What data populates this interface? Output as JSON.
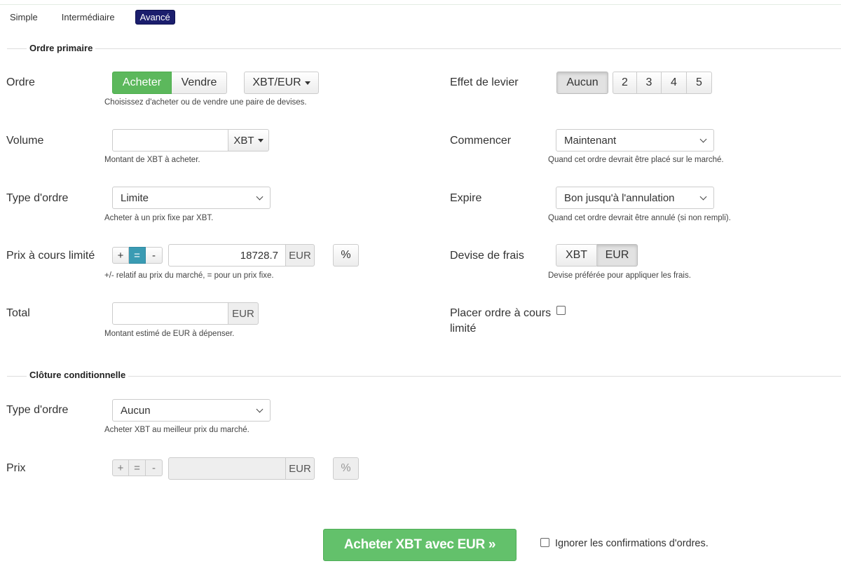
{
  "modes": {
    "simple": "Simple",
    "intermediate": "Intermédiaire",
    "advanced": "Avancé"
  },
  "primary": {
    "title": "Ordre primaire",
    "order": {
      "label": "Ordre",
      "buy": "Acheter",
      "sell": "Vendre",
      "pair": "XBT/EUR",
      "help": "Choisissez d'acheter ou de vendre une paire de devises."
    },
    "volume": {
      "label": "Volume",
      "value": "",
      "unit": "XBT",
      "help": "Montant de XBT à acheter."
    },
    "order_type": {
      "label": "Type d'ordre",
      "selected": "Limite",
      "help": "Acheter à un prix fixe par XBT."
    },
    "limit_price": {
      "label": "Prix à cours limité",
      "plus": "+",
      "equal": "=",
      "minus": "-",
      "value": "18728.7",
      "unit": "EUR",
      "percent": "%",
      "help": "+/- relatif au prix du marché, = pour un prix fixe."
    },
    "total": {
      "label": "Total",
      "value": "",
      "unit": "EUR",
      "help": "Montant estimé de EUR à dépenser."
    },
    "leverage": {
      "label": "Effet de levier",
      "none": "Aucun",
      "options": [
        "2",
        "3",
        "4",
        "5"
      ]
    },
    "start": {
      "label": "Commencer",
      "selected": "Maintenant",
      "help": "Quand cet ordre devrait être placé sur le marché."
    },
    "expire": {
      "label": "Expire",
      "selected": "Bon jusqu'à l'annulation",
      "help": "Quand cet ordre devrait être annulé (si non rempli)."
    },
    "fee_currency": {
      "label": "Devise de frais",
      "xbt": "XBT",
      "eur": "EUR",
      "help": "Devise préférée pour appliquer les frais."
    },
    "post_limit": {
      "label_line1": "Placer ordre à cours",
      "label_line2": "limité"
    }
  },
  "conditional": {
    "title": "Clôture conditionnelle",
    "order_type": {
      "label": "Type d'ordre",
      "selected": "Aucun",
      "help": "Acheter XBT au meilleur prix du marché."
    },
    "price": {
      "label": "Prix",
      "plus": "+",
      "equal": "=",
      "minus": "-",
      "value": "",
      "unit": "EUR",
      "percent": "%"
    }
  },
  "submit": {
    "label": "Acheter XBT avec EUR »",
    "ignore_confirm": "Ignorer les confirmations d'ordres."
  },
  "colors": {
    "green": "#5cb85c",
    "active_mode": "#1b1e6d",
    "teal": "#3a9bb3"
  }
}
